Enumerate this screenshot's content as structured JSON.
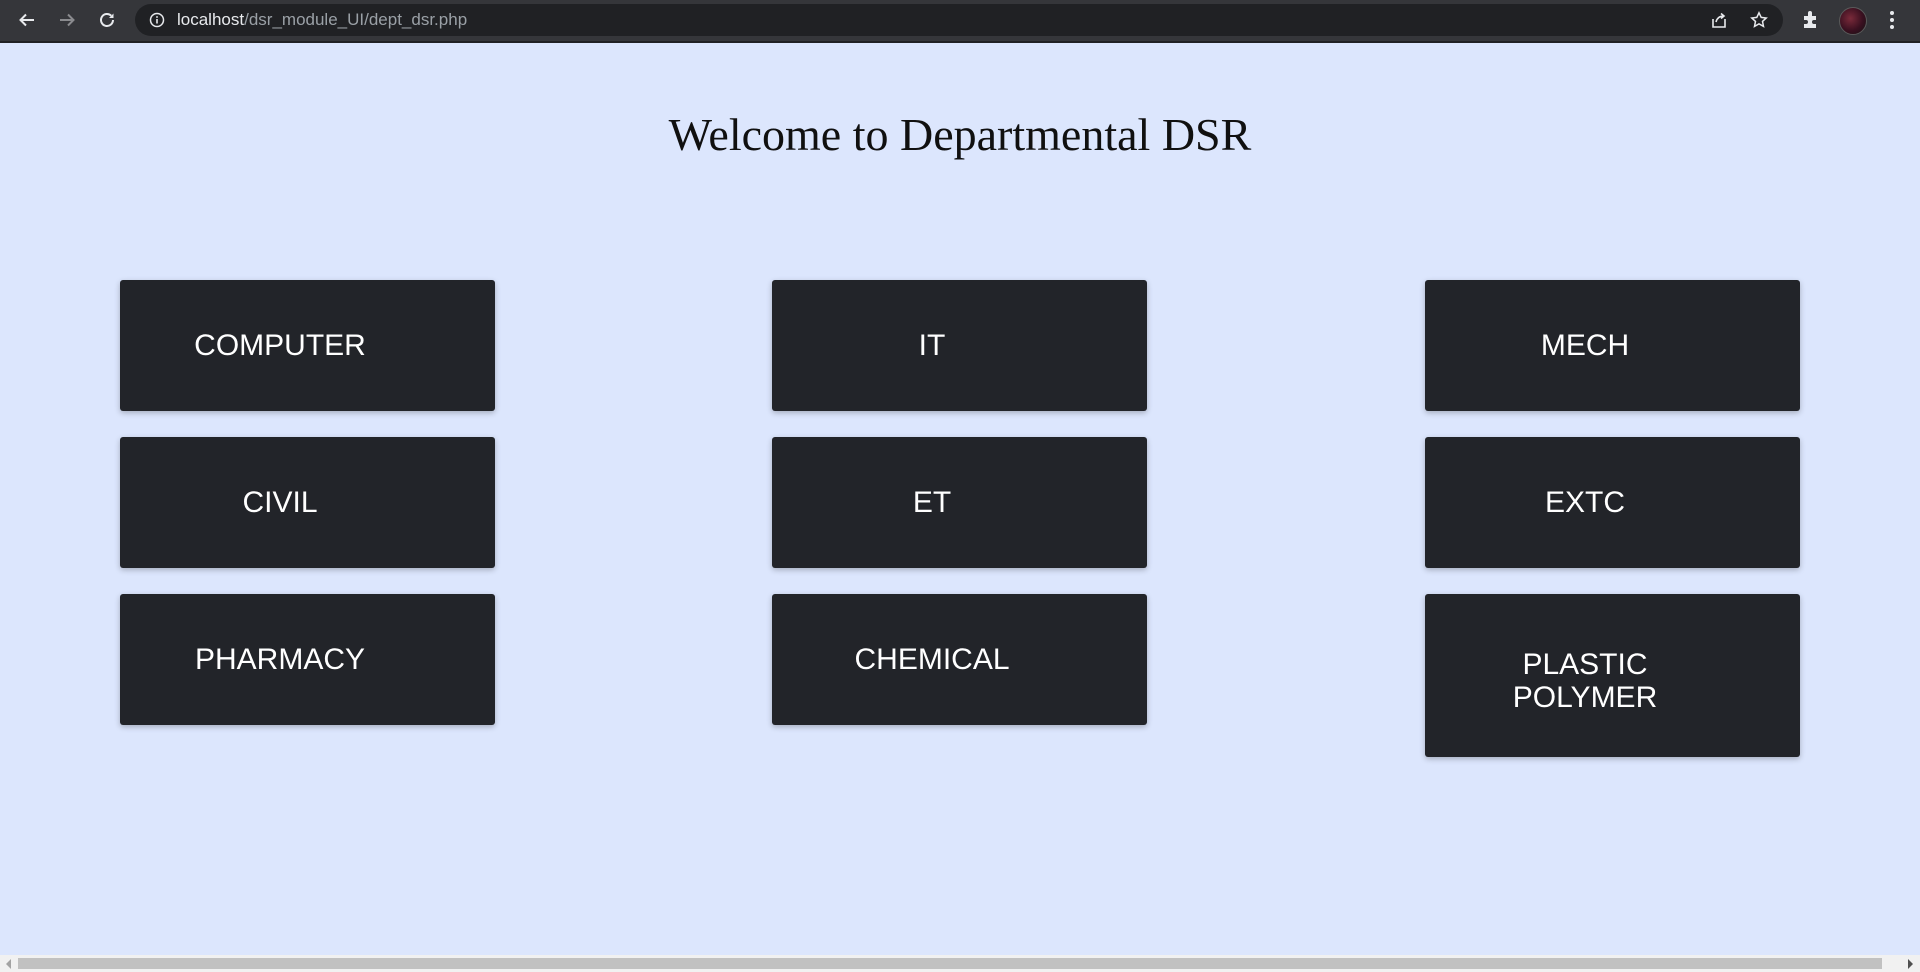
{
  "browser": {
    "url_host": "localhost",
    "url_path": "/dsr_module_UI/dept_dsr.php"
  },
  "page": {
    "title": "Welcome to Departmental DSR"
  },
  "departments": [
    {
      "label": "COMPUTER"
    },
    {
      "label": "IT"
    },
    {
      "label": "MECH"
    },
    {
      "label": "CIVIL"
    },
    {
      "label": "ET"
    },
    {
      "label": "EXTC"
    },
    {
      "label": "PHARMACY"
    },
    {
      "label": "CHEMICAL"
    },
    {
      "label": "PLASTIC POLYMER"
    }
  ],
  "colors": {
    "page_background": "#dce6fd",
    "button_background": "#222429",
    "button_text": "#ffffff",
    "toolbar": "#35363a"
  }
}
